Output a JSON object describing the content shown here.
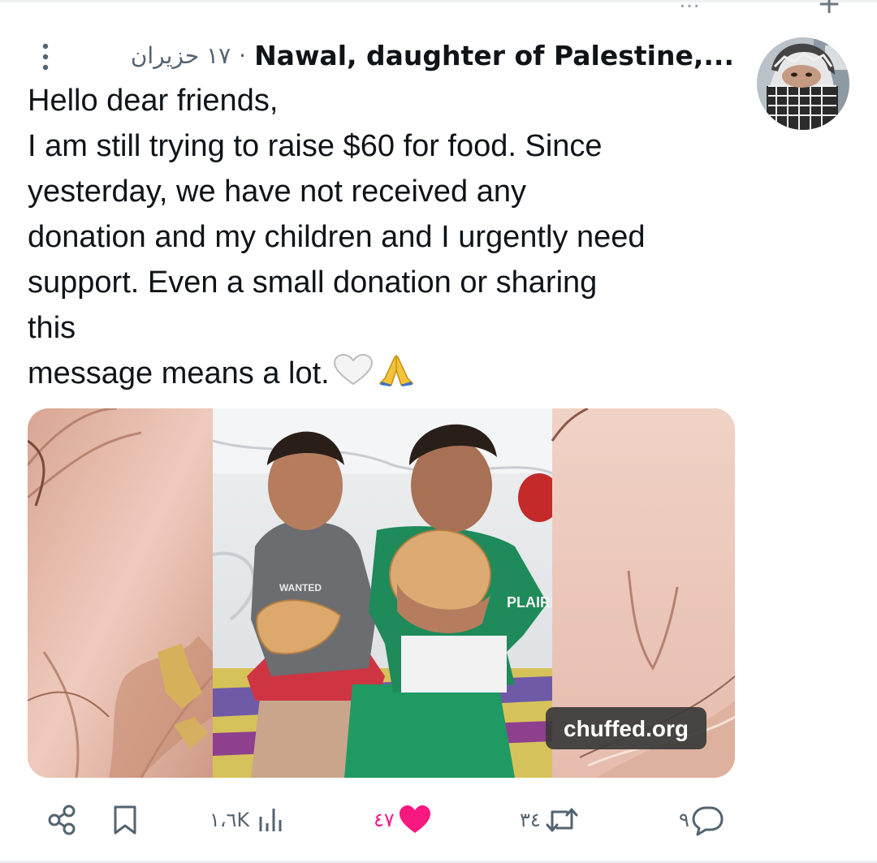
{
  "colors": {
    "text": "#0f1419",
    "secondary": "#536471",
    "like": "#f91880",
    "badge_bg": "#3a3a3a"
  },
  "header": {
    "author_name": "Nawal, daughter of Palestine,...",
    "separator": "·",
    "time": "١٧ حزيران",
    "more_icon": "more-vertical-icon"
  },
  "tweet": {
    "lines": [
      "Hello dear friends,",
      "I am still trying to raise $60 for food. Since",
      "yesterday, we have not received any",
      "donation and my children and I urgently need",
      "support. Even a small donation or sharing",
      "this",
      "message means a lot."
    ],
    "emojis": [
      "white-heart-icon",
      "folded-hands-icon"
    ]
  },
  "media": {
    "shirt_text": "WANTED",
    "shirt_text2": "PLAIRI",
    "watermark": "chuffed.org"
  },
  "actions": {
    "reply_count": "٩",
    "repost_count": "٣٤",
    "like_count": "٤٧",
    "views_count": "١،٦K",
    "icons": [
      "share-icon",
      "bookmark-icon",
      "views-icon",
      "like-icon",
      "repost-icon",
      "reply-icon"
    ]
  }
}
